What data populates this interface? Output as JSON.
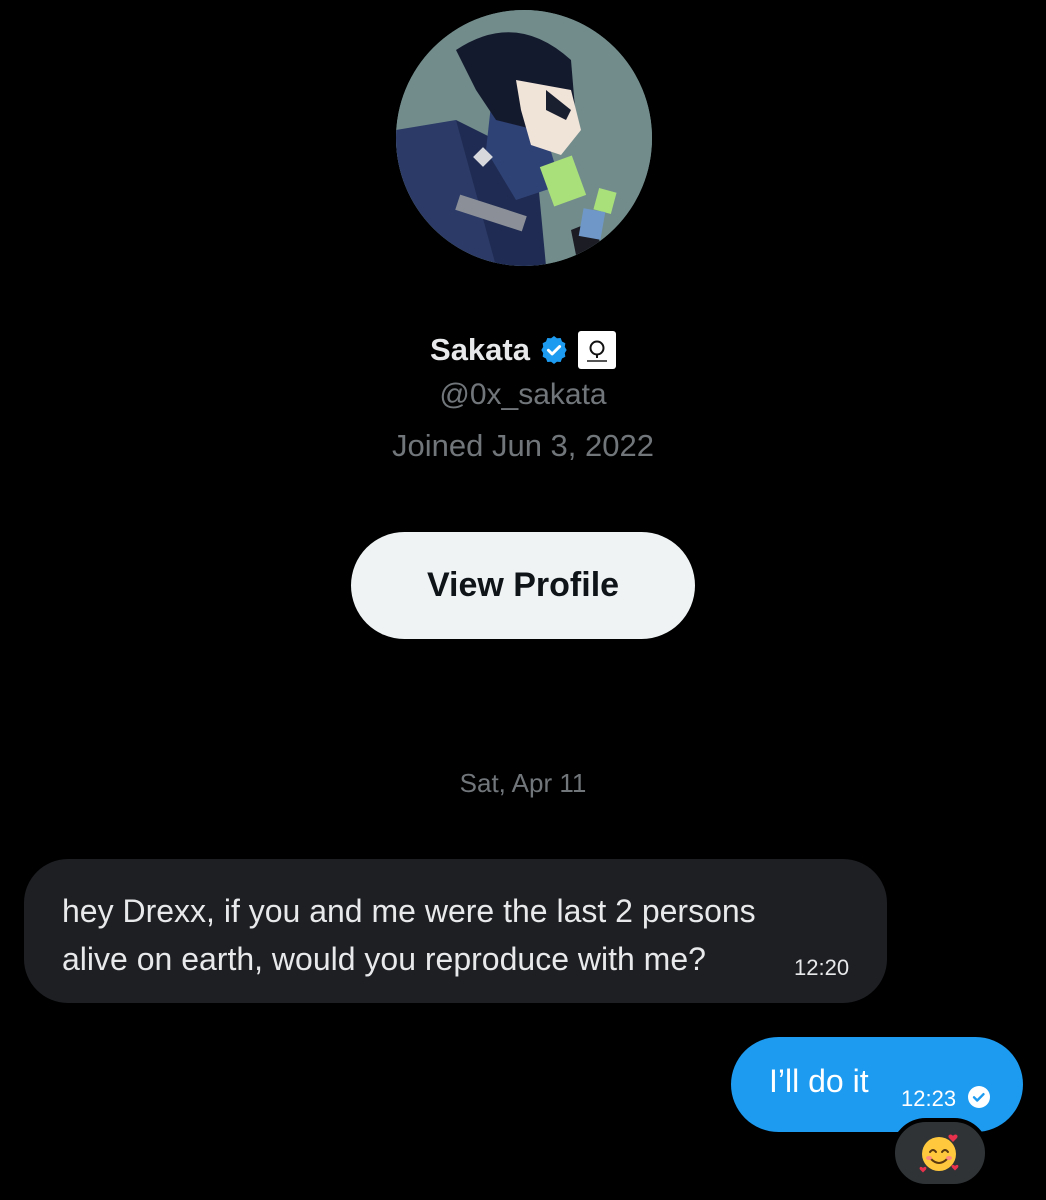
{
  "profile": {
    "display_name": "Sakata",
    "handle": "@0x_sakata",
    "joined": "Joined Jun 3, 2022",
    "view_profile_label": "View Profile",
    "badges": [
      "verified-icon",
      "affiliate-badge"
    ]
  },
  "conversation": {
    "date_separator": "Sat, Apr 11",
    "messages": [
      {
        "direction": "incoming",
        "text": "hey Drexx, if you and me were the last 2 persons alive on earth, would you reproduce with me?",
        "time": "12:20"
      },
      {
        "direction": "outgoing",
        "text": "I’ll do it",
        "time": "12:23",
        "status_icon": "read-check-icon",
        "reaction": "smiling-face-with-hearts"
      }
    ]
  },
  "colors": {
    "background": "#000000",
    "outgoing_bubble": "#1d9bf0",
    "incoming_bubble": "#1d1f23",
    "secondary_text": "#71767b",
    "verified": "#1d9bf0",
    "button_bg": "#eff3f4"
  }
}
